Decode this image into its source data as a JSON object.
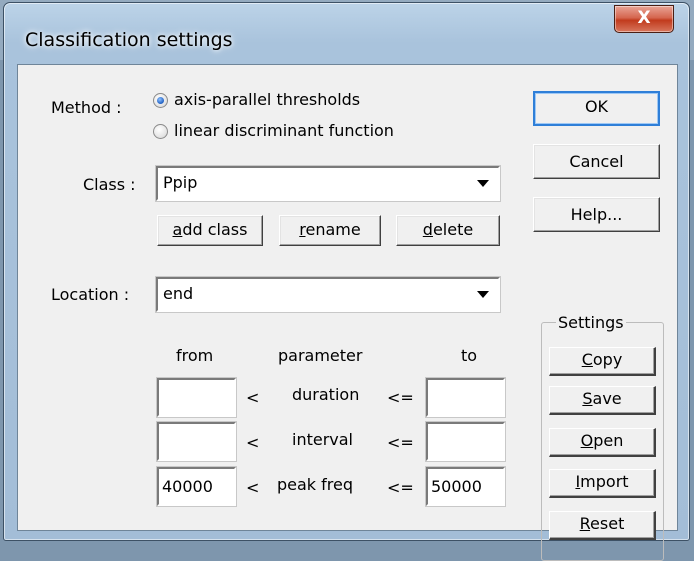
{
  "dialog": {
    "title": "Classification settings",
    "close_glyph": "X"
  },
  "method": {
    "label": "Method :",
    "options": [
      {
        "label": "axis-parallel thresholds",
        "checked": true
      },
      {
        "label": "linear discriminant function",
        "checked": false
      }
    ]
  },
  "class": {
    "label": "Class :",
    "selected": "Ppip",
    "buttons": {
      "add_class": {
        "mnemonic": "a",
        "rest": "dd class"
      },
      "rename": {
        "mnemonic": "r",
        "rest": "ename"
      },
      "delete": {
        "mnemonic": "d",
        "rest": "elete"
      }
    }
  },
  "location": {
    "label": "Location :",
    "selected": "end"
  },
  "thresholds": {
    "headers": {
      "from": "from",
      "parameter": "parameter",
      "to": "to"
    },
    "rows": [
      {
        "from": "",
        "op_left": "<",
        "parameter": "duration",
        "op_right": "<=",
        "to": ""
      },
      {
        "from": "",
        "op_left": "<",
        "parameter": "interval",
        "op_right": "<=",
        "to": ""
      },
      {
        "from": "40000",
        "op_left": "<",
        "parameter": "peak freq",
        "op_right": "<=",
        "to": "50000"
      }
    ]
  },
  "actions": {
    "ok": "OK",
    "cancel": "Cancel",
    "help": "Help..."
  },
  "settings": {
    "title": "Settings",
    "buttons": [
      {
        "mnemonic": "C",
        "rest": "opy"
      },
      {
        "mnemonic": "S",
        "rest": "ave"
      },
      {
        "mnemonic": "O",
        "rest": "pen"
      },
      {
        "mnemonic": "I",
        "rest": "mport"
      },
      {
        "mnemonic": "R",
        "rest": "eset"
      }
    ]
  },
  "colors": {
    "default_button_border": "#2f7fd8",
    "title_bar": "#a9c3dc",
    "close_button": "#c13b1d"
  }
}
